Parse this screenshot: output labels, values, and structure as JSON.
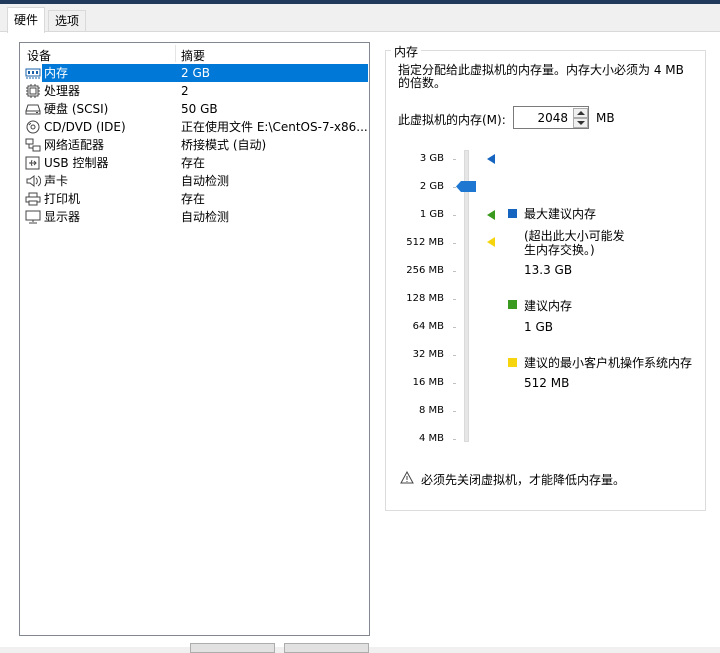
{
  "tabs": [
    {
      "label": "硬件",
      "active": true
    },
    {
      "label": "选项",
      "active": false
    }
  ],
  "device_list": {
    "columns": [
      "设备",
      "摘要"
    ],
    "rows": [
      {
        "name": "内存",
        "summary": "2 GB",
        "icon": "memory-icon",
        "selected": true
      },
      {
        "name": "处理器",
        "summary": "2",
        "icon": "processor-icon"
      },
      {
        "name": "硬盘 (SCSI)",
        "summary": "50 GB",
        "icon": "hard-disk-icon"
      },
      {
        "name": "CD/DVD (IDE)",
        "summary": "正在使用文件 E:\\CentOS-7-x86...",
        "icon": "cd-dvd-icon"
      },
      {
        "name": "网络适配器",
        "summary": "桥接模式 (自动)",
        "icon": "network-adapter-icon"
      },
      {
        "name": "USB 控制器",
        "summary": "存在",
        "icon": "usb-controller-icon"
      },
      {
        "name": "声卡",
        "summary": "自动检测",
        "icon": "sound-card-icon"
      },
      {
        "name": "打印机",
        "summary": "存在",
        "icon": "printer-icon"
      },
      {
        "name": "显示器",
        "summary": "自动检测",
        "icon": "display-icon"
      }
    ]
  },
  "memory": {
    "group_title": "内存",
    "description": "指定分配给此虚拟机的内存量。内存大小必须为 4 MB 的倍数。",
    "field_label": "此虚拟机的内存(M):",
    "value": "2048",
    "unit": "MB",
    "scale_labels": [
      "3 GB",
      "2 GB",
      "1 GB",
      "512 MB",
      "256 MB",
      "128 MB",
      "64 MB",
      "32 MB",
      "16 MB",
      "8 MB",
      "4 MB"
    ],
    "slider_value_label": "2 GB",
    "legend": {
      "max_recommended": {
        "title": "最大建议内存",
        "note": "(超出此大小可能发生内存交换。)",
        "value": "13.3 GB",
        "color": "#1565c0"
      },
      "recommended": {
        "title": "建议内存",
        "value": "1 GB",
        "color": "#3a9a1f"
      },
      "min_recommended": {
        "title": "建议的最小客户机操作系统内存",
        "value": "512 MB",
        "color": "#f6d50f"
      }
    },
    "warning": "必须先关闭虚拟机，才能降低内存量。"
  },
  "colors": {
    "selection": "#0078d7",
    "slider_thumb": "#1e78d2"
  }
}
